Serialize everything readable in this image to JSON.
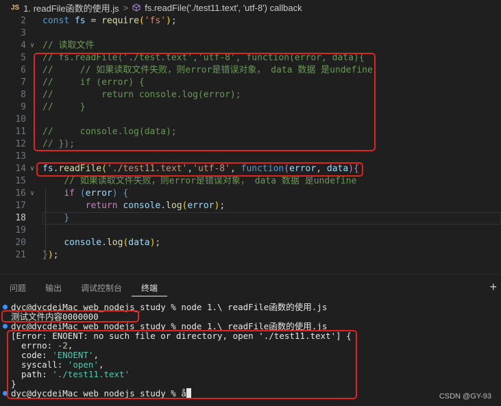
{
  "breadcrumb": {
    "file_badge": "JS",
    "file": "1. readFile函数的使用.js",
    "separator": ">",
    "symbol": "fs.readFile('./test11.text', 'utf-8') callback"
  },
  "editor": {
    "lines": [
      {
        "n": "2",
        "segs": [
          [
            "kw",
            "const"
          ],
          [
            "pun",
            " "
          ],
          [
            "var",
            "fs"
          ],
          [
            "pun",
            " = "
          ],
          [
            "fnc",
            "require"
          ],
          [
            "br",
            "("
          ],
          [
            "str",
            "'fs'"
          ],
          [
            "br",
            ")"
          ],
          [
            "pun",
            ";"
          ]
        ]
      },
      {
        "n": "3",
        "segs": []
      },
      {
        "n": "4",
        "fold": true,
        "segs": [
          [
            "cmt",
            "// 读取文件"
          ]
        ]
      },
      {
        "n": "5",
        "segs": [
          [
            "cmt",
            "// fs.readFile('./test.text','utf-8', function(error, data){"
          ]
        ]
      },
      {
        "n": "6",
        "segs": [
          [
            "cmt",
            "//     // 如果读取文件失败，则error是错误对象， data 数据 是undefine"
          ]
        ]
      },
      {
        "n": "7",
        "segs": [
          [
            "cmt",
            "//     if (error) {"
          ]
        ]
      },
      {
        "n": "8",
        "segs": [
          [
            "cmt",
            "//         return console.log(error);"
          ]
        ]
      },
      {
        "n": "9",
        "segs": [
          [
            "cmt",
            "//     }"
          ]
        ]
      },
      {
        "n": "10",
        "segs": []
      },
      {
        "n": "11",
        "segs": [
          [
            "cmt",
            "//     console.log(data);"
          ]
        ]
      },
      {
        "n": "12",
        "segs": [
          [
            "cmt",
            "// });"
          ]
        ]
      },
      {
        "n": "13",
        "segs": []
      },
      {
        "n": "14",
        "fold": true,
        "segs": [
          [
            "var",
            "fs"
          ],
          [
            "pun",
            "."
          ],
          [
            "fnc",
            "readFile"
          ],
          [
            "br",
            "("
          ],
          [
            "str",
            "'./test11.text'"
          ],
          [
            "pun",
            ","
          ],
          [
            "str",
            "'utf-8'"
          ],
          [
            "pun",
            ", "
          ],
          [
            "kw",
            "function"
          ],
          [
            "kw2",
            "("
          ],
          [
            "var",
            "error"
          ],
          [
            "pun",
            ", "
          ],
          [
            "var",
            "data"
          ],
          [
            "kw2",
            ")"
          ],
          [
            "kw2",
            "{"
          ]
        ]
      },
      {
        "n": "15",
        "segs": [
          [
            "pun",
            "    "
          ],
          [
            "cmt",
            "// 如果读取文件失败，则error是错误对象， data 数据 是undefine"
          ]
        ]
      },
      {
        "n": "16",
        "fold": true,
        "segs": [
          [
            "pun",
            "    "
          ],
          [
            "kw2",
            "if"
          ],
          [
            "pun",
            " "
          ],
          [
            "kw",
            "("
          ],
          [
            "var",
            "error"
          ],
          [
            "kw",
            ")"
          ],
          [
            "pun",
            " "
          ],
          [
            "kw",
            "{"
          ]
        ]
      },
      {
        "n": "17",
        "segs": [
          [
            "pun",
            "        "
          ],
          [
            "kw2",
            "return"
          ],
          [
            "pun",
            " "
          ],
          [
            "var",
            "console"
          ],
          [
            "pun",
            "."
          ],
          [
            "fnc",
            "log"
          ],
          [
            "br",
            "("
          ],
          [
            "var",
            "error"
          ],
          [
            "br",
            ")"
          ],
          [
            "pun",
            ";"
          ]
        ]
      },
      {
        "n": "18",
        "active": true,
        "segs": [
          [
            "pun",
            "    "
          ],
          [
            "kw",
            "}"
          ]
        ]
      },
      {
        "n": "19",
        "segs": []
      },
      {
        "n": "20",
        "segs": [
          [
            "pun",
            "    "
          ],
          [
            "var",
            "console"
          ],
          [
            "pun",
            "."
          ],
          [
            "fnc",
            "log"
          ],
          [
            "br",
            "("
          ],
          [
            "var",
            "data"
          ],
          [
            "br",
            ")"
          ],
          [
            "pun",
            ";"
          ]
        ]
      },
      {
        "n": "21",
        "segs": [
          [
            "kw2",
            "}"
          ],
          [
            "br",
            ")"
          ],
          [
            "pun",
            ";"
          ]
        ]
      }
    ]
  },
  "panel": {
    "tabs": [
      {
        "label": "问题",
        "active": false
      },
      {
        "label": "输出",
        "active": false
      },
      {
        "label": "调试控制台",
        "active": false
      },
      {
        "label": "终端",
        "active": true
      }
    ],
    "add_label": "+",
    "terminal": [
      {
        "dot": true,
        "segs": [
          [
            "t",
            "dyc@dycdeiMac web_nodejs_study % node 1.\\ readFile函数的使用.js"
          ]
        ]
      },
      {
        "segs": [
          [
            "t",
            "测试文件内容0000000"
          ]
        ]
      },
      {
        "dot": true,
        "segs": [
          [
            "t",
            "dyc@dycdeiMac web_nodejs_study % node 1.\\ readFile函数的使用.js"
          ]
        ]
      },
      {
        "segs": [
          [
            "t",
            "[Error: ENOENT: no such file or directory, open './test11.text'] {"
          ]
        ]
      },
      {
        "segs": [
          [
            "t",
            "  errno: "
          ],
          [
            "tnum",
            "-2"
          ],
          [
            "t",
            ","
          ]
        ]
      },
      {
        "segs": [
          [
            "t",
            "  code: "
          ],
          [
            "tstr",
            "'ENOENT'"
          ],
          [
            "t",
            ","
          ]
        ]
      },
      {
        "segs": [
          [
            "t",
            "  syscall: "
          ],
          [
            "tstr",
            "'open'"
          ],
          [
            "t",
            ","
          ]
        ]
      },
      {
        "segs": [
          [
            "t",
            "  path: "
          ],
          [
            "tstr",
            "'./test11.text'"
          ]
        ]
      },
      {
        "segs": [
          [
            "t",
            "}"
          ]
        ]
      },
      {
        "dot": true,
        "cursor": true,
        "segs": [
          [
            "t",
            "dyc@dycdeiMac web_nodejs_study % å"
          ]
        ]
      }
    ]
  },
  "watermark": "CSDN @GY-93"
}
